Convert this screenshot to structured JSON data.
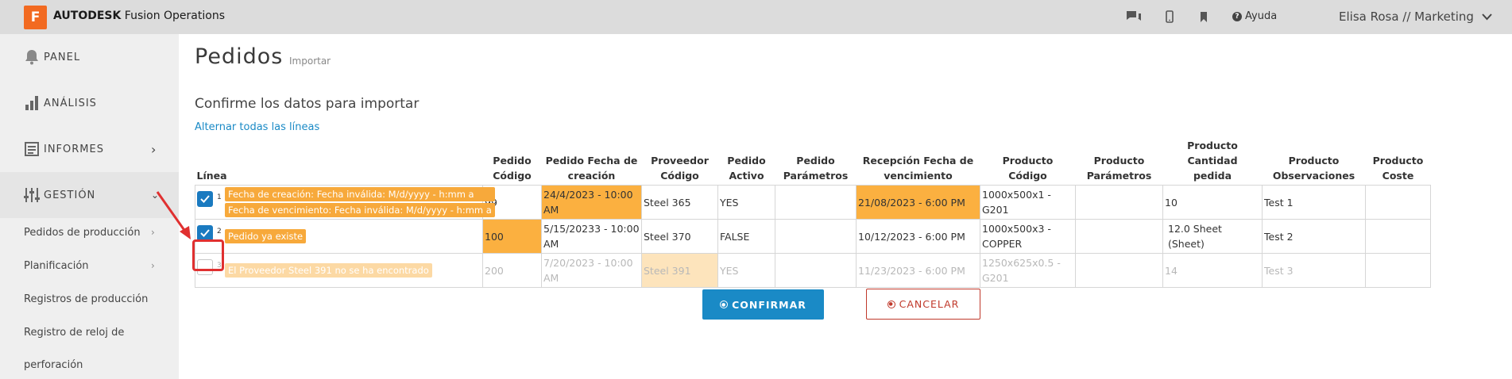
{
  "app": {
    "logo_letter": "F",
    "brand_bold": "AUTODESK",
    "brand_rest": " Fusion Operations",
    "help_label": "Ayuda",
    "user_label": "Elisa Rosa // Marketing",
    "icons": [
      "chat-icon",
      "mobile-icon",
      "bookmark-icon",
      "help-icon",
      "chevron-down-icon"
    ]
  },
  "sidebar": {
    "panel": "PANEL",
    "analisis": "ANÁLISIS",
    "informes": "INFORMES",
    "gestion": "GESTIÓN",
    "sub_items": [
      "Pedidos de producción",
      "Planificación",
      "Registros de producción",
      "Registro de reloj de",
      "perforación"
    ]
  },
  "page": {
    "title": "Pedidos",
    "subtitle": "Importar",
    "heading": "Confirme los datos para importar",
    "toggle_link": "Alternar todas las líneas"
  },
  "table": {
    "headers": {
      "linea": "Línea",
      "pedido_codigo": [
        "Pedido",
        "Código"
      ],
      "pedido_fecha": [
        "Pedido Fecha de",
        "creación"
      ],
      "proveedor": [
        "Proveedor",
        "Código"
      ],
      "activo": [
        "Pedido",
        "Activo"
      ],
      "parametros": [
        "Pedido",
        "Parámetros"
      ],
      "recepcion": [
        "Recepción Fecha de",
        "vencimiento"
      ],
      "prod_codigo": [
        "Producto Código"
      ],
      "prod_param": [
        "Producto",
        "Parámetros"
      ],
      "cantidad": [
        "Producto Cantidad",
        "pedida"
      ],
      "observ": [
        "Producto",
        "Observaciones"
      ],
      "coste": [
        "Producto",
        "Coste"
      ]
    },
    "rows": [
      {
        "num": "1",
        "checked": true,
        "tags": [
          "Fecha de creación: Fecha inválida: M/d/yyyy - h:mm a",
          "Fecha de vencimiento: Fecha inválida: M/d/yyyy - h:mm a"
        ],
        "codigo": "99",
        "fecha": "24/4/2023 - 10:00 AM",
        "proveedor": "Steel 365",
        "activo": "YES",
        "parametros": "",
        "recepcion": "21/08/2023 - 6:00 PM",
        "prod_codigo": "1000x500x1 - G201",
        "prod_param": "",
        "cantidad": "10",
        "observ": "Test 1",
        "coste": ""
      },
      {
        "num": "2",
        "checked": true,
        "tags": [
          "Pedido ya existe"
        ],
        "codigo": "100",
        "fecha": "5/15/20233 - 10:00 AM",
        "proveedor": "Steel 370",
        "activo": "FALSE",
        "parametros": "",
        "recepcion": "10/12/2023 - 6:00 PM",
        "prod_codigo": "1000x500x3 - COPPER",
        "prod_param": "",
        "cantidad": "12.0 Sheet (Sheet)",
        "observ": "Test 2",
        "coste": ""
      },
      {
        "num": "3",
        "checked": false,
        "tags": [
          "El Proveedor Steel 391 no se ha encontrado"
        ],
        "codigo": "200",
        "fecha": "7/20/2023 - 10:00 AM",
        "proveedor": "Steel 391",
        "activo": "YES",
        "parametros": "",
        "recepcion": "11/23/2023 - 6:00 PM",
        "prod_codigo": "1250x625x0.5 - G201",
        "prod_param": "",
        "cantidad": "14",
        "observ": "Test 3",
        "coste": ""
      }
    ]
  },
  "buttons": {
    "confirm": "CONFIRMAR",
    "cancel": "CANCELAR"
  },
  "colors": {
    "accent_blue": "#1a8ac6",
    "warning_orange": "#fbb040",
    "cancel_red": "#c0392b",
    "logo_orange": "#f26a21"
  }
}
